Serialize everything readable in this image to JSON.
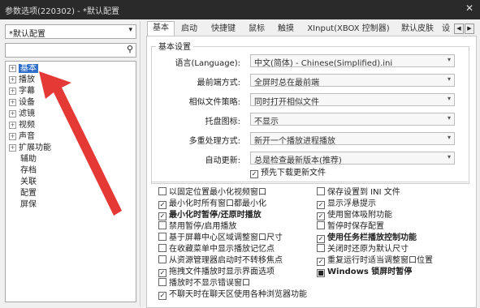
{
  "window": {
    "title": "参数选项(220302) - *默认配置",
    "close": "✕"
  },
  "preset": {
    "value": "*默认配置",
    "arrow": "▾"
  },
  "search": {
    "value": "",
    "icon": "search-icon"
  },
  "tree": [
    {
      "label": "基本",
      "expander": "+",
      "selected": true
    },
    {
      "label": "播放",
      "expander": "+"
    },
    {
      "label": "字幕",
      "expander": "+"
    },
    {
      "label": "设备",
      "expander": "+"
    },
    {
      "label": "滤镜",
      "expander": "+"
    },
    {
      "label": "视频",
      "expander": "+"
    },
    {
      "label": "声音",
      "expander": "+"
    },
    {
      "label": "扩展功能",
      "expander": "+"
    },
    {
      "label": "辅助",
      "expander": ""
    },
    {
      "label": "存档",
      "expander": ""
    },
    {
      "label": "关联",
      "expander": ""
    },
    {
      "label": "配置",
      "expander": ""
    },
    {
      "label": "屏保",
      "expander": ""
    }
  ],
  "tabs": [
    "基本",
    "启动",
    "快捷键",
    "鼠标",
    "触摸",
    "XInput(XBOX 控制器)",
    "默认皮肤",
    "设"
  ],
  "tab_nav": {
    "prev": "◀",
    "next": "▶"
  },
  "basic": {
    "group_title": "基本设置",
    "rows": [
      {
        "label": "语言(Language):",
        "value": "中文(简体) - Chinese(Simplified).ini"
      },
      {
        "label": "最前端方式:",
        "value": "全屏时总在最前端"
      },
      {
        "label": "相似文件策略:",
        "value": "同时打开相似文件"
      },
      {
        "label": "托盘图标:",
        "value": "不显示"
      },
      {
        "label": "多重处理方式:",
        "value": "新开一个播放进程播放"
      },
      {
        "label": "自动更新:",
        "value": "总是检查最新版本(推荐)"
      }
    ],
    "predownload": {
      "label": "预先下载更新文件",
      "checked": true
    }
  },
  "options_left": [
    {
      "label": "以固定位置最小化视频窗口",
      "checked": false,
      "bold": false
    },
    {
      "label": "最小化时所有窗口都最小化",
      "checked": true,
      "bold": false
    },
    {
      "label": "最小化时暂停/还原时播放",
      "checked": true,
      "bold": true
    },
    {
      "label": "禁用暂停/启用播放",
      "checked": false,
      "bold": false
    },
    {
      "label": "基于屏幕中心区域调整窗口尺寸",
      "checked": false,
      "bold": false
    },
    {
      "label": "在收藏菜单中显示播放记忆点",
      "checked": false,
      "bold": false
    },
    {
      "label": "从资源管理器启动时不转移焦点",
      "checked": false,
      "bold": false
    },
    {
      "label": "拖拽文件播放时显示界面选项",
      "checked": true,
      "bold": false
    },
    {
      "label": "播放时不显示错误窗口",
      "checked": false,
      "bold": false
    },
    {
      "label": "不聊天时在聊天区使用各种浏览器功能",
      "checked": true,
      "bold": false
    }
  ],
  "options_right": [
    {
      "label": "保存设置到 INI 文件",
      "checked": false,
      "bold": false
    },
    {
      "label": "显示浮悬提示",
      "checked": true,
      "bold": false
    },
    {
      "label": "使用窗体吸附功能",
      "checked": true,
      "bold": false
    },
    {
      "label": "暂停时保存配置",
      "checked": false,
      "bold": false
    },
    {
      "label": "使用任务栏播放控制功能",
      "checked": true,
      "bold": true
    },
    {
      "label": "关闭时还原为默认尺寸",
      "checked": false,
      "bold": false
    },
    {
      "label": "重复运行时适当调整窗口位置",
      "checked": true,
      "bold": false
    },
    {
      "label": "Windows 锁屏时暂停",
      "checked": "partial",
      "bold": true
    }
  ],
  "colors": {
    "arrow": "#e53935",
    "selection": "#2f6fc9",
    "titlebar": "#2a2a2a"
  }
}
